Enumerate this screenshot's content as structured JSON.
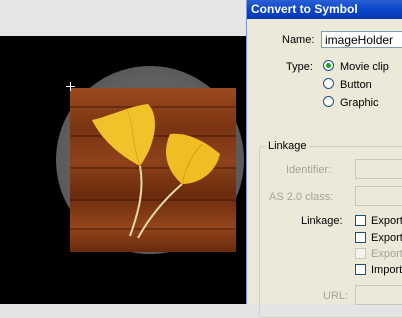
{
  "dialog": {
    "title": "Convert to Symbol",
    "name_label": "Name:",
    "name_value": "imageHolder",
    "type_label": "Type:",
    "type_options": [
      "Movie clip",
      "Button",
      "Graphic"
    ],
    "linkage_group_title": "Linkage",
    "identifier_label": "Identifier:",
    "as2_class_label": "AS 2.0 class:",
    "linkage_label": "Linkage:",
    "linkage_checks": [
      "Export",
      "Export",
      "Export",
      "Import"
    ],
    "url_label": "URL:"
  }
}
